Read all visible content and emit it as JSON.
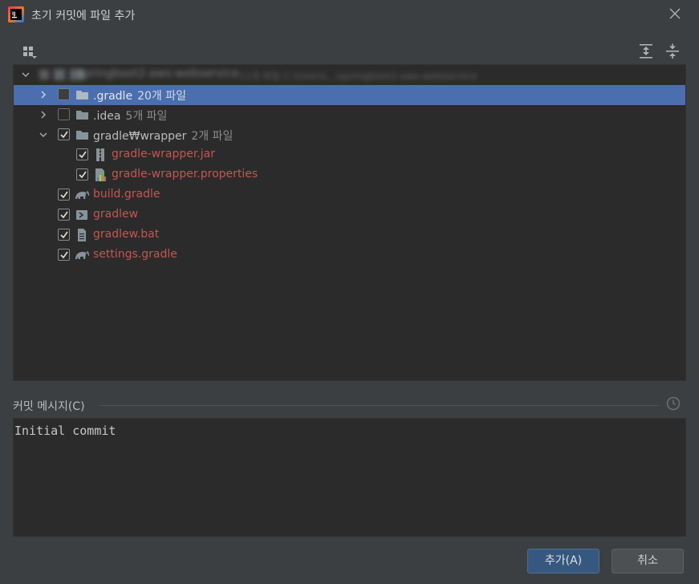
{
  "window": {
    "title": "초기 커밋에 파일 추가"
  },
  "tree": {
    "root": {
      "label": "springboot2-aws-webservice",
      "detail": "11개 파일  C:\\Users\\...\\springboot2-aws-webservice"
    },
    "rows": [
      {
        "name": ".gradle",
        "count": "20개 파일"
      },
      {
        "name": ".idea",
        "count": "5개 파일"
      },
      {
        "name": "gradle₩wrapper",
        "count": "2개 파일"
      },
      {
        "name": "gradle-wrapper.jar"
      },
      {
        "name": "gradle-wrapper.properties"
      },
      {
        "name": "build.gradle"
      },
      {
        "name": "gradlew"
      },
      {
        "name": "gradlew.bat"
      },
      {
        "name": "settings.gradle"
      }
    ]
  },
  "commit": {
    "section_label": "커밋 메시지(C)",
    "message": "Initial commit"
  },
  "buttons": {
    "add": "추가(A)",
    "cancel": "취소"
  },
  "colors": {
    "selection": "#4b6eaf",
    "unversioned": "#c75450",
    "primary_button": "#365880"
  }
}
